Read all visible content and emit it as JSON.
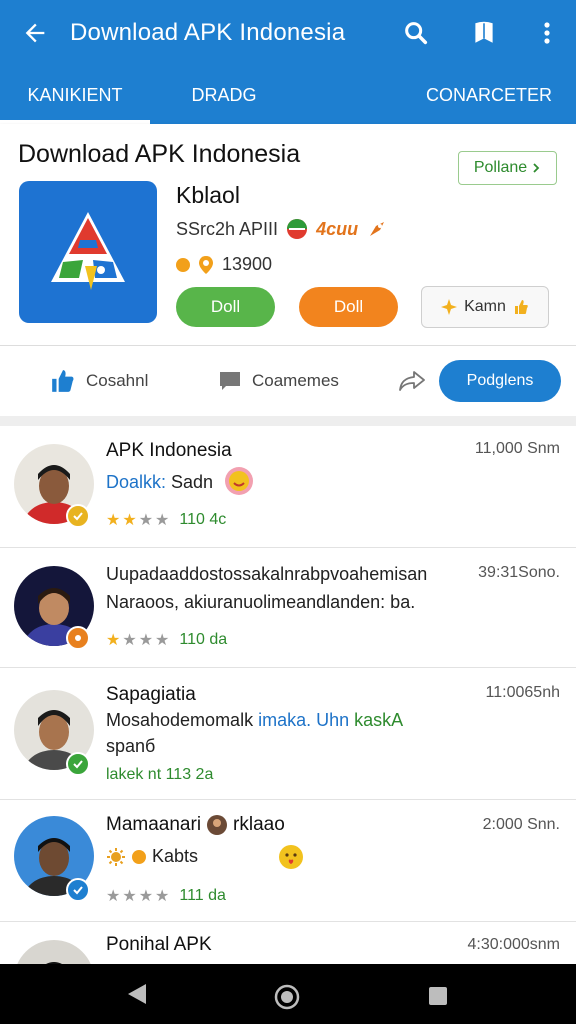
{
  "appbar": {
    "title": "Download APK Indonesia",
    "icons": [
      "back-arrow-icon",
      "search-icon",
      "bookmark-icon",
      "more-vertical-icon"
    ]
  },
  "tabs": [
    {
      "label": "KANIKIENT",
      "active": true
    },
    {
      "label": "DRADG",
      "active": false
    },
    {
      "label": "CONARCETER",
      "active": false
    }
  ],
  "header": {
    "title": "Download APK Indonesia",
    "pill_label": "Pollane",
    "app_name": "Kblaol",
    "meta_text": "SSrc2h APIII",
    "rating_text": "4cuu",
    "count_text": "13900",
    "btn_green": "Doll",
    "btn_orange": "Doll",
    "btn_outline": "Kamn",
    "actions": {
      "like": "Cosahnl",
      "comment": "Coamemes",
      "primary": "Podglens"
    }
  },
  "feed": [
    {
      "name": "APK Indonesia",
      "time": "11,000 Snm",
      "line1_blue": "Doalkk:",
      "line1_rest": " Sadn",
      "stars": 2,
      "count": "110 4c",
      "badge_color": "#e8b320"
    },
    {
      "name": "",
      "time": "39:31Sono.",
      "line1": "Uupadaaddostossakalnrabpvoahemisan",
      "line2": "Naraoos, akiuranuolimeandlanden: ba.",
      "stars": 1,
      "count": "110 da",
      "badge_color": "#e8801e"
    },
    {
      "name": "Sapagiatia",
      "time": "11:0065nh",
      "line1_start": "Mosahodemomalk ",
      "line1_blue": "imaka. Uhn ",
      "line1_green": "kaskA",
      "line2": "spanб",
      "stars_text": "lakek nt 113 2a",
      "badge_color": "#3aa53a"
    },
    {
      "name": "Mamaanari",
      "name_suffix": "rklaao",
      "time": "2:000 Snn.",
      "line1": "Kabts",
      "stars": 0,
      "count": "111 da",
      "badge_color": "#1e7fd0"
    },
    {
      "name": "Ponihal APK",
      "time": "4:30:000snm"
    }
  ],
  "colors": {
    "primary": "#1e7fd0",
    "green": "#58b54a",
    "orange": "#f2841e"
  }
}
